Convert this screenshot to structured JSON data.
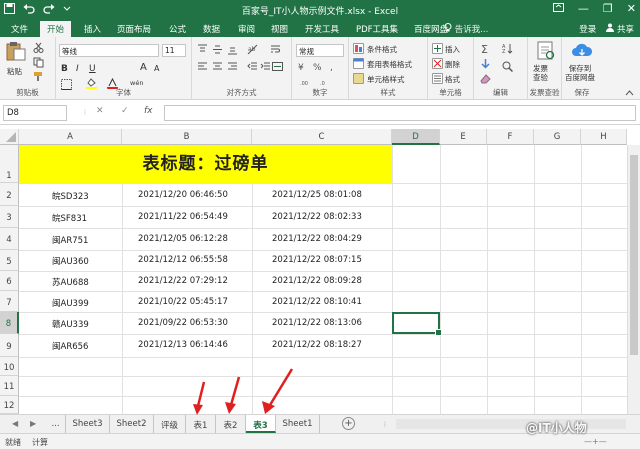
{
  "titlebar": {
    "title": "百家号_IT小人物示例文件.xlsx - Excel",
    "save_icon": "save-icon",
    "undo_icon": "undo-icon",
    "redo_icon": "redo-icon",
    "customize_icon": "customize-icon",
    "ribbon_options_icon": "ribbon-options-icon",
    "minimize": "—",
    "restore": "❐",
    "close": "✕"
  },
  "ribbon_tabs": [
    "文件",
    "开始",
    "插入",
    "页面布局",
    "公式",
    "数据",
    "审阅",
    "视图",
    "开发工具",
    "PDF工具集",
    "百度网盘"
  ],
  "active_tab": "开始",
  "tell_me": "告诉我...",
  "login": "登录",
  "share": "共享",
  "ribbon": {
    "clipboard": {
      "paste": "粘贴",
      "label": "剪贴板"
    },
    "font": {
      "name": "等线",
      "size": "11",
      "label": "字体",
      "bold": "B",
      "italic": "I",
      "underline": "U",
      "grow": "A",
      "shrink": "A",
      "wen": "wén"
    },
    "alignment": {
      "label": "对齐方式"
    },
    "number": {
      "format": "常规",
      "label": "数字"
    },
    "styles": {
      "conditional": "条件格式",
      "table": "套用表格格式",
      "cell": "单元格样式",
      "label": "样式"
    },
    "cells": {
      "insert": "插入",
      "delete": "删除",
      "format": "格式",
      "label": "单元格"
    },
    "editing": {
      "label": "编辑"
    },
    "invoice": {
      "button": "发票\n查验",
      "label": "发票查验"
    },
    "save": {
      "button": "保存到\n百度网盘",
      "label": "保存"
    }
  },
  "formula_bar": {
    "name_box": "D8",
    "cancel": "✕",
    "enter": "✓",
    "fx": "fx",
    "value": ""
  },
  "columns": [
    "A",
    "B",
    "C",
    "D",
    "E",
    "F",
    "G",
    "H"
  ],
  "selected_column": "D",
  "rows": [
    "1",
    "2",
    "3",
    "4",
    "5",
    "6",
    "7",
    "8",
    "9",
    "10",
    "11",
    "12"
  ],
  "selected_row": "8",
  "sheet_title": "表标题：过磅单",
  "table": [
    [
      "皖SD323",
      "2021/12/20 06:46:50",
      "2021/12/25 08:01:08"
    ],
    [
      "皖SF831",
      "2021/11/22 06:54:49",
      "2021/12/22 08:02:33"
    ],
    [
      "闽AR751",
      "2021/12/05 06:12:28",
      "2021/12/22 08:04:29"
    ],
    [
      "闽AU360",
      "2021/12/12 06:55:58",
      "2021/12/22 08:07:15"
    ],
    [
      "苏AU688",
      "2021/12/22 07:29:12",
      "2021/12/22 08:09:28"
    ],
    [
      "闽AU399",
      "2021/10/22 05:45:17",
      "2021/12/22 08:10:41"
    ],
    [
      "赣AU339",
      "2021/09/22 06:53:30",
      "2021/12/22 08:13:06"
    ],
    [
      "闽AR656",
      "2021/12/13 06:14:46",
      "2021/12/22 08:18:27"
    ]
  ],
  "sheets": [
    "...",
    "Sheet3",
    "Sheet2",
    "评级",
    "表1",
    "表2",
    "表3",
    "Sheet1"
  ],
  "active_sheet": "表3",
  "status": {
    "ready": "就绪",
    "calc": "计算"
  },
  "watermark": "@IT小人物",
  "colors": {
    "excel_green": "#217346",
    "title_fill": "#ffff00",
    "arrow_red": "#e02020"
  }
}
